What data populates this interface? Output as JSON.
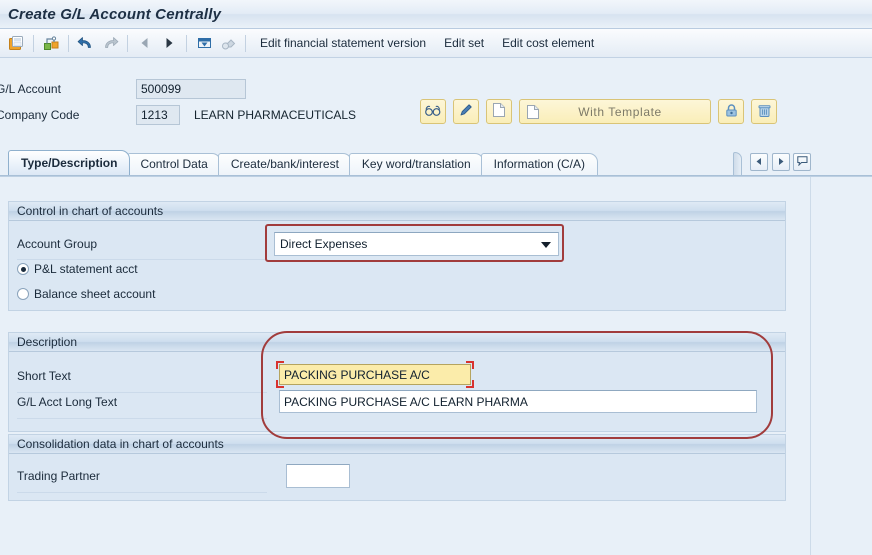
{
  "window": {
    "title": "Create G/L Account Centrally"
  },
  "toolbar": {
    "icons": [
      {
        "name": "save-icon"
      },
      {
        "name": "check-entries-icon"
      },
      {
        "name": "undo-icon"
      },
      {
        "name": "redo-icon"
      },
      {
        "name": "previous-icon"
      },
      {
        "name": "next-icon"
      },
      {
        "name": "print-icon"
      },
      {
        "name": "find-icon"
      }
    ],
    "menu_items": [
      {
        "label": "Edit financial statement version"
      },
      {
        "label": "Edit set"
      },
      {
        "label": "Edit cost element"
      }
    ]
  },
  "header": {
    "gl_account_label": "G/L Account",
    "gl_account_value": "500099",
    "company_code_label": "Company Code",
    "company_code_value": "1213",
    "company_name": "LEARN PHARMACEUTICALS",
    "actions": [
      {
        "name": "display-button",
        "icon": "glasses-icon",
        "label": ""
      },
      {
        "name": "change-button",
        "icon": "pencil-icon",
        "label": ""
      },
      {
        "name": "create-button",
        "icon": "page-icon",
        "label": ""
      },
      {
        "name": "with-template-button",
        "icon": "page-icon",
        "label": "With Template"
      },
      {
        "name": "block-button",
        "icon": "lock-icon",
        "label": ""
      },
      {
        "name": "delete-button",
        "icon": "trash-icon",
        "label": ""
      }
    ],
    "with_template_label": "With Template"
  },
  "tabs": {
    "items": [
      {
        "label": "Type/Description",
        "active": true
      },
      {
        "label": "Control Data",
        "active": false
      },
      {
        "label": "Create/bank/interest",
        "active": false
      },
      {
        "label": "Key word/translation",
        "active": false
      },
      {
        "label": "Information (C/A)",
        "active": false
      }
    ],
    "nav": {
      "prev_icon": "chevron-left-icon",
      "next_icon": "chevron-right-icon",
      "list_icon": "tab-list-icon"
    }
  },
  "sections": {
    "control": {
      "title": "Control in chart of accounts",
      "account_group_label": "Account Group",
      "account_group_value": "Direct Expenses",
      "radios": [
        {
          "label": "P&L statement acct",
          "selected": true
        },
        {
          "label": "Balance sheet account",
          "selected": false
        }
      ]
    },
    "description": {
      "title": "Description",
      "short_text_label": "Short Text",
      "short_text_value": "PACKING PURCHASE A/C",
      "long_text_label": "G/L Acct Long Text",
      "long_text_value": "PACKING PURCHASE A/C LEARN PHARMA"
    },
    "consolidation": {
      "title": "Consolidation data in chart of accounts",
      "trading_partner_label": "Trading Partner",
      "trading_partner_value": ""
    }
  },
  "colors": {
    "highlight": "#a13c3c",
    "focus_field": "#fbecaa",
    "focus_marker": "#d8332f",
    "panel_bg": "#dbe7f3",
    "page_bg": "#e8f0f8",
    "action_button": "#faeeb8"
  }
}
